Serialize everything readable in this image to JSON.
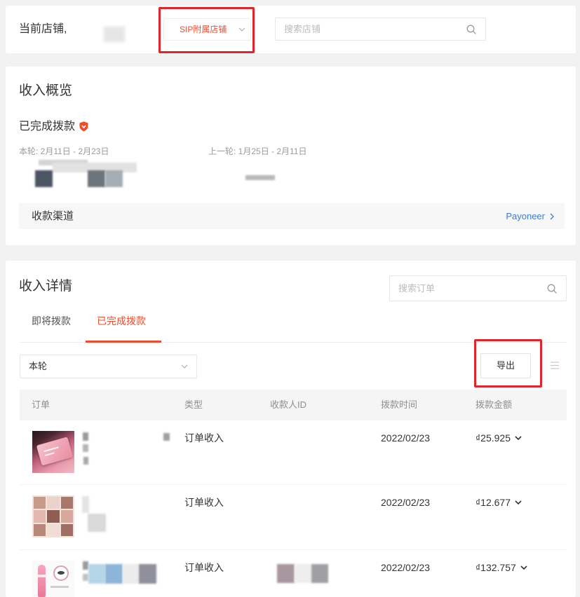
{
  "colors": {
    "accent": "#ee4d2d",
    "link": "#3b7dd8",
    "highlight": "#e0262b"
  },
  "store_bar": {
    "label": "当前店铺,",
    "store_select": {
      "value": "SIP附属店铺",
      "icon": "chevron-down-icon"
    },
    "search": {
      "placeholder": "搜索店铺",
      "icon": "search-icon"
    }
  },
  "overview": {
    "title": "收入概览",
    "completed": {
      "label": "已完成拨款",
      "icon": "shield-icon"
    },
    "current_period": "本轮: 2月11日 - 2月23日",
    "previous_period": "上一轮: 1月25日 - 2月11日",
    "channel": {
      "label": "收款渠道",
      "value": "Payoneer",
      "icon": "chevron-right-icon"
    }
  },
  "details": {
    "title": "收入详情",
    "search": {
      "placeholder": "搜索订单",
      "icon": "search-icon"
    },
    "tabs": [
      {
        "label": "即将拨款",
        "active": false
      },
      {
        "label": "已完成拨款",
        "active": true
      }
    ],
    "period_select": {
      "value": "本轮",
      "icon": "chevron-down-icon"
    },
    "export_label": "导出",
    "view_icon": "list-icon",
    "columns": [
      "订单",
      "类型",
      "收款人ID",
      "拨款时间",
      "拨款金额"
    ],
    "rows": [
      {
        "type": "订单收入",
        "date": "2022/02/23",
        "amount": "₫25.925",
        "expand_icon": "chevron-down-icon"
      },
      {
        "type": "订单收入",
        "date": "2022/02/23",
        "amount": "₫12.677",
        "expand_icon": "chevron-down-icon"
      },
      {
        "type": "订单收入",
        "date": "2022/02/23",
        "amount": "₫132.757",
        "expand_icon": "chevron-down-icon"
      }
    ]
  }
}
